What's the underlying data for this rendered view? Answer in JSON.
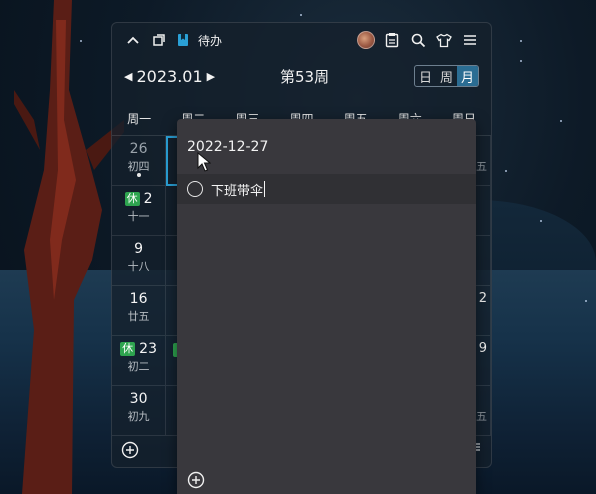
{
  "toolbar": {
    "title": "待办",
    "icons": [
      "collapse-icon",
      "window-icon",
      "book-icon",
      "avatar",
      "clipboard-icon",
      "search-icon",
      "shirt-icon",
      "menu-icon"
    ]
  },
  "nav": {
    "month": "2023.01",
    "week": "第53周",
    "views": [
      "日",
      "周",
      "月"
    ],
    "active_view": "月"
  },
  "weekdays": [
    "周一",
    "周二",
    "周三",
    "周四",
    "周五",
    "周六",
    "周日"
  ],
  "calendar": {
    "col1": [
      {
        "day": "26",
        "lunar": "初四",
        "dim": true,
        "dot": true
      },
      {
        "rest": "休",
        "day": "2",
        "lunar": "十一"
      },
      {
        "day": "9",
        "lunar": "十八"
      },
      {
        "day": "16",
        "lunar": "廿五"
      },
      {
        "rest": "休",
        "day": "23",
        "lunar": "初二"
      },
      {
        "day": "30",
        "lunar": "初九"
      }
    ],
    "edge_right": [
      {
        "row": 0,
        "lunar": "五"
      },
      {
        "row": 3,
        "num": "2"
      },
      {
        "row": 4,
        "num": "9"
      },
      {
        "row": 5,
        "lunar": "五"
      }
    ]
  },
  "popup": {
    "date": "2022-12-27",
    "todos": [
      {
        "text": "下班带伞",
        "done": false
      }
    ]
  },
  "colors": {
    "accent": "#2aa0d6",
    "rest_badge": "#2ea44f",
    "popup_bg": "#39383d",
    "active_view": "#2b6d93"
  }
}
